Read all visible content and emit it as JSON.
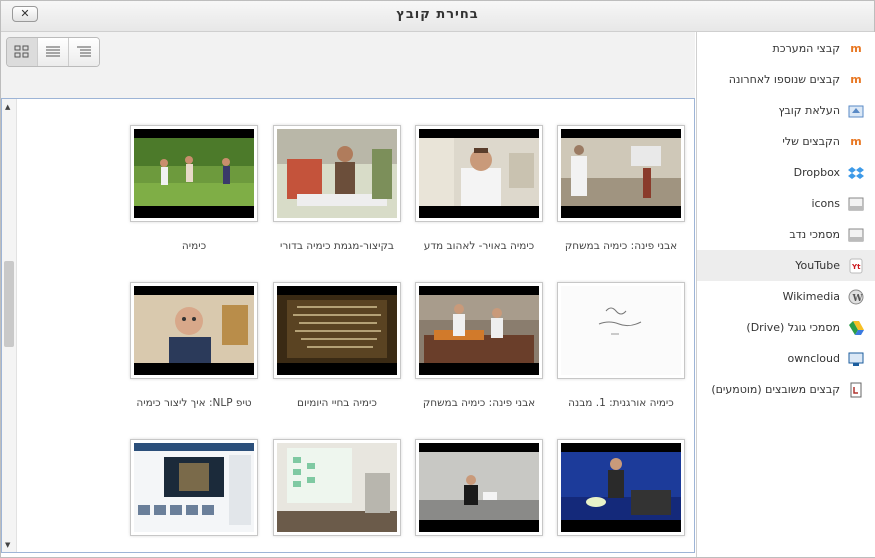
{
  "dialog": {
    "title": "בחירת קובץ",
    "close_label": "✕"
  },
  "toolbar": {
    "views": [
      "icons-view",
      "list-view",
      "tree-view"
    ]
  },
  "sidebar": {
    "items": [
      {
        "label": "קבצי המערכת",
        "icon": "moodle-icon",
        "color": "#e87722"
      },
      {
        "label": "קבצים שנוספו לאחרונה",
        "icon": "moodle-icon",
        "color": "#e87722"
      },
      {
        "label": "העלאת קובץ",
        "icon": "upload-icon",
        "color": "#5a8ac6"
      },
      {
        "label": "הקבצים שלי",
        "icon": "moodle-icon",
        "color": "#e87722"
      },
      {
        "label": "Dropbox",
        "icon": "dropbox-icon",
        "color": "#3d9ae8"
      },
      {
        "label": "icons",
        "icon": "folder-icon",
        "color": "#888888"
      },
      {
        "label": "מסמכי נדב",
        "icon": "folder-icon",
        "color": "#888888"
      },
      {
        "label": "YouTube",
        "icon": "youtube-icon",
        "color": "#cc181e"
      },
      {
        "label": "Wikimedia",
        "icon": "wikimedia-icon",
        "color": "#777777"
      },
      {
        "label": "מסמכי גוגל (Drive)",
        "icon": "google-drive-icon",
        "color": "#2a9d48"
      },
      {
        "label": "owncloud",
        "icon": "owncloud-icon",
        "color": "#1d5e9e"
      },
      {
        "label": "קבצים משובצים (מוטמעים)",
        "icon": "embedded-files-icon",
        "color": "#b0332f"
      }
    ],
    "active_index": 7
  },
  "files": [
    {
      "label": "אבני פינה: כימיה במשחק"
    },
    {
      "label": "כימיה באויר- לאהוב מדע"
    },
    {
      "label": "בקיצור-מגמת כימיה בדורי"
    },
    {
      "label": "כימיה"
    },
    {
      "label": "כימיה אורגנית: 1. מבנה"
    },
    {
      "label": "אבני פינה: כימיה במשחק"
    },
    {
      "label": "כימיה בחיי היומיום"
    },
    {
      "label": "טיפ NLP: איך ליצור כימיה"
    },
    {
      "label": ""
    },
    {
      "label": ""
    },
    {
      "label": ""
    },
    {
      "label": ""
    }
  ]
}
